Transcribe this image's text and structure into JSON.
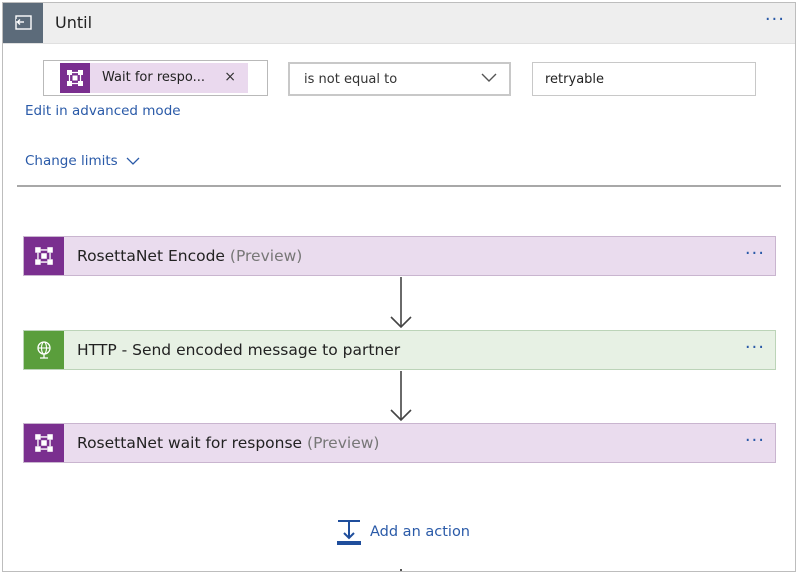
{
  "until": {
    "title": "Until",
    "more_label": "···"
  },
  "condition": {
    "token_label": "Wait for respo...",
    "token_close": "×",
    "operator": "is not equal to",
    "value": "retryable"
  },
  "links": {
    "advanced": "Edit in advanced mode",
    "limits": "Change limits"
  },
  "actions": [
    {
      "title": "RosettaNet Encode",
      "suffix": " (Preview)",
      "more": "···"
    },
    {
      "title": "HTTP - Send encoded message to partner",
      "suffix": "",
      "more": "···"
    },
    {
      "title": "RosettaNet wait for response",
      "suffix": " (Preview)",
      "more": "···"
    }
  ],
  "add_action": {
    "label": "Add an action"
  },
  "colors": {
    "accent": "#2a5aa8",
    "rosettanet": "#7a2f8f",
    "rosettanet_bg": "#eadcee",
    "http": "#5a9e3c",
    "http_bg": "#e7f1e4",
    "until_icon": "#5c6b7a"
  },
  "icons": {
    "until": "loop-back-icon",
    "rosettanet": "rosettanet-connector-icon",
    "http": "globe-icon",
    "dropdown": "chevron-down-icon",
    "add_action": "add-step-icon"
  }
}
